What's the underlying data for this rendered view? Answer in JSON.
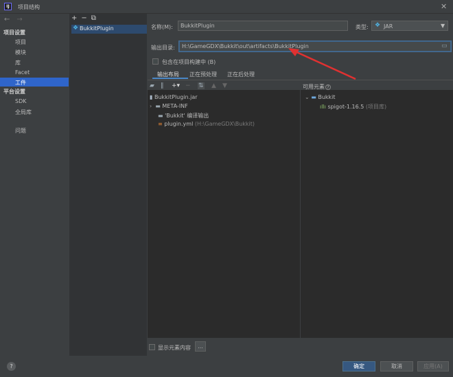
{
  "window": {
    "title": "项目结构",
    "app_icon": "IJ"
  },
  "nav": {
    "back_icon": "arrow-left-icon",
    "forward_icon": "arrow-right-icon",
    "sections": [
      {
        "label": "项目设置",
        "items": [
          "项目",
          "模块",
          "库",
          "Facet",
          "工件"
        ]
      },
      {
        "label": "平台设置",
        "items": [
          "SDK",
          "全局库"
        ]
      }
    ],
    "problems": "问题",
    "selected": "工件"
  },
  "artifacts": {
    "tools": [
      "+",
      "−",
      "⧉"
    ],
    "items": [
      {
        "label": "BukkitPlugin",
        "icon": "artifact-jar-icon"
      }
    ]
  },
  "detail": {
    "name_label": "名称(M):",
    "name_value": "BukkitPlugin",
    "type_label": "类型:",
    "type_value": "JAR",
    "output_label": "输出目录:",
    "output_value": "H:\\GameGDX\\Bukkit\\out\\artifacts\\BukkitPlugin",
    "include_label": "包含在项目构建中 (B)",
    "tabs": [
      "输出布局",
      "正在预处理",
      "正在后处理"
    ],
    "active_tab": "输出布局"
  },
  "layout_tree": [
    {
      "label": "BukkitPlugin.jar",
      "icon": "jar-icon",
      "depth": 0,
      "note": ""
    },
    {
      "label": "META-INF",
      "icon": "folder-icon",
      "depth": 1,
      "note": "",
      "expandable": true
    },
    {
      "label": "'Bukkit' 编译输出",
      "icon": "folder-icon",
      "depth": 1,
      "note": ""
    },
    {
      "label": "plugin.yml",
      "icon": "yml-file-icon",
      "depth": 1,
      "note": "(H:\\GameGDX\\Bukkit)"
    }
  ],
  "available": {
    "header": "可用元素",
    "help_icon": "question-icon",
    "tree": [
      {
        "label": "Bukkit",
        "icon": "module-folder-icon",
        "depth": 0,
        "expanded": true,
        "note": ""
      },
      {
        "label": "spigot-1.16.5",
        "icon": "library-icon",
        "depth": 1,
        "note": "(项目库)"
      }
    ]
  },
  "footer": {
    "show_content_label": "显示元素内容",
    "more_label": "...",
    "ok": "确定",
    "cancel": "取消",
    "apply": "应用(A)",
    "help": "?"
  },
  "colors": {
    "selection": "#2f65ca",
    "primary_button": "#365880",
    "annotation_arrow": "#e03131"
  }
}
